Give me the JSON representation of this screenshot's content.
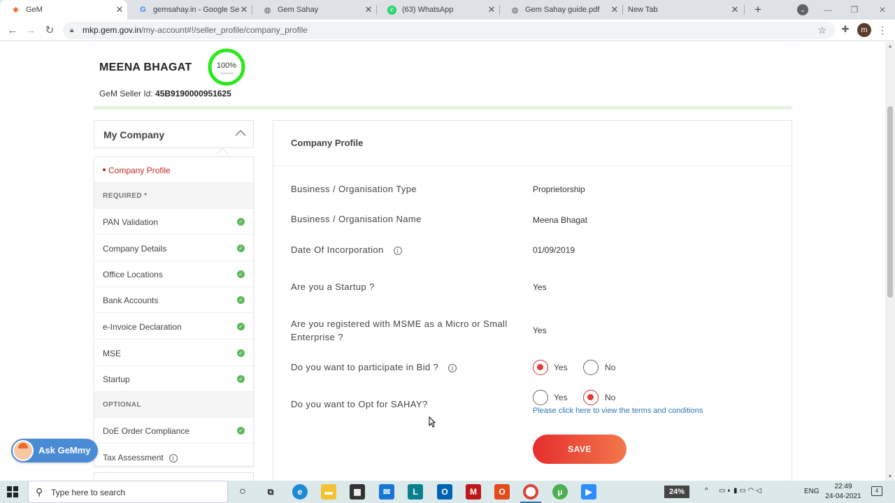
{
  "browser": {
    "tabs": [
      {
        "title": "GeM",
        "favicon": "gem-icon"
      },
      {
        "title": "gemsahay.in - Google Search",
        "favicon": "google-icon"
      },
      {
        "title": "Gem Sahay",
        "favicon": "globe-icon"
      },
      {
        "title": "(63) WhatsApp",
        "favicon": "whatsapp-icon"
      },
      {
        "title": "Gem Sahay guide.pdf",
        "favicon": "globe-icon"
      },
      {
        "title": "New Tab",
        "favicon": "none"
      }
    ],
    "url_host": "mkp.gem.gov.in",
    "url_path": "/my-account#!/seller_profile/company_profile",
    "profile_initial": "m"
  },
  "seller": {
    "name": "MEENA BHAGAT",
    "completion": "100%",
    "completion_fraction": 1.0,
    "completion_sub": "completed",
    "seller_id_label": "GeM Seller Id:",
    "seller_id": "45B9190000951625"
  },
  "sidebar": {
    "header": "My Company",
    "active_item": "Company Profile",
    "required_label": "REQUIRED *",
    "required_items": [
      {
        "label": "PAN Validation",
        "done": true
      },
      {
        "label": "Company Details",
        "done": true
      },
      {
        "label": "Office Locations",
        "done": true
      },
      {
        "label": "Bank Accounts",
        "done": true
      },
      {
        "label": "e-Invoice Declaration",
        "done": true
      },
      {
        "label": "MSE",
        "done": true
      },
      {
        "label": "Startup",
        "done": true
      }
    ],
    "optional_label": "OPTIONAL",
    "optional_items": [
      {
        "label": "DoE Order Compliance",
        "done": true
      },
      {
        "label": "Tax Assessment",
        "info": true
      }
    ]
  },
  "ask_gemmy": {
    "label": "Ask GeMmy"
  },
  "profile": {
    "title": "Company Profile",
    "fields": [
      {
        "label": "Business / Organisation Type",
        "value": "Proprietorship"
      },
      {
        "label": "Business / Organisation Name",
        "value": "Meena Bhagat"
      },
      {
        "label": "Date Of Incorporation",
        "value": "01/09/2019"
      },
      {
        "label": "Are you a Startup ?",
        "value": "Yes"
      },
      {
        "label": "Are you registered with MSME as a Micro or Small Enterprise ?",
        "value": "Yes"
      }
    ],
    "bid_question": "Do you want to participate in Bid ?",
    "bid_options": [
      "Yes",
      "No"
    ],
    "bid_selected": "Yes",
    "sahay_question": "Do you want to Opt for SAHAY?",
    "sahay_options": [
      "Yes",
      "No"
    ],
    "sahay_selected": "No",
    "terms_link": "Please click here to view the terms and conditions",
    "save_label": "SAVE"
  },
  "taskbar": {
    "search_placeholder": "Type here to search",
    "battery_percent": "24%",
    "language": "ENG",
    "time": "22:49",
    "date": "24-04-2021",
    "notification_count": "4"
  },
  "colors": {
    "accent_red": "#e53935",
    "success_green": "#5cb85c",
    "progress_green": "#2ee81f",
    "link_blue": "#2a7ab8",
    "ask_blue": "#4a8bd6"
  }
}
